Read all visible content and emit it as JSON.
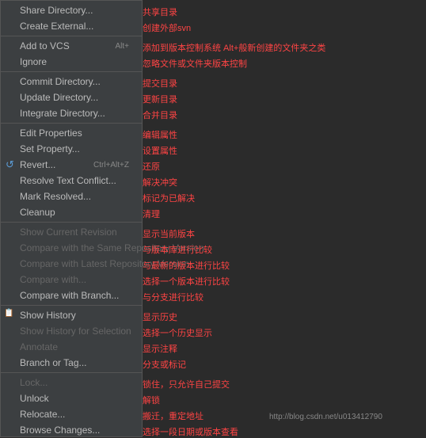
{
  "menu": {
    "items": [
      {
        "id": "share-directory",
        "label": "Share Directory...",
        "disabled": false,
        "shortcut": "",
        "annotation": "共享目录"
      },
      {
        "id": "create-external",
        "label": "Create External...",
        "disabled": false,
        "shortcut": "",
        "annotation": "创建外部svn"
      },
      {
        "id": "separator1",
        "type": "separator"
      },
      {
        "id": "add-to-vcs",
        "label": "Add to VCS",
        "disabled": false,
        "shortcut": "Alt+",
        "annotation": "添加到版本控制系统 Alt+般新创建的文件夹之类"
      },
      {
        "id": "ignore",
        "label": "Ignore",
        "disabled": false,
        "shortcut": "",
        "annotation": "忽略文件或文件夹版本控制"
      },
      {
        "id": "separator2",
        "type": "separator"
      },
      {
        "id": "commit-directory",
        "label": "Commit Directory...",
        "disabled": false,
        "shortcut": "",
        "annotation": "提交目录"
      },
      {
        "id": "update-directory",
        "label": "Update Directory...",
        "disabled": false,
        "shortcut": "",
        "annotation": "更新目录"
      },
      {
        "id": "integrate-directory",
        "label": "Integrate Directory...",
        "disabled": false,
        "shortcut": "",
        "annotation": "合并目录"
      },
      {
        "id": "separator3",
        "type": "separator"
      },
      {
        "id": "edit-properties",
        "label": "Edit Properties",
        "disabled": false,
        "shortcut": "",
        "annotation": "编辑属性"
      },
      {
        "id": "set-property",
        "label": "Set Property...",
        "disabled": false,
        "shortcut": "",
        "annotation": "设置属性"
      },
      {
        "id": "revert",
        "label": "Revert...",
        "disabled": false,
        "shortcut": "Ctrl+Alt+Z",
        "annotation": "还原",
        "icon": "revert"
      },
      {
        "id": "resolve-text-conflict",
        "label": "Resolve Text Conflict...",
        "disabled": false,
        "shortcut": "",
        "annotation": "解决冲突"
      },
      {
        "id": "mark-resolved",
        "label": "Mark Resolved...",
        "disabled": false,
        "shortcut": "",
        "annotation": "标记为已解决"
      },
      {
        "id": "cleanup",
        "label": "Cleanup",
        "disabled": false,
        "shortcut": "",
        "annotation": "清理"
      },
      {
        "id": "separator4",
        "type": "separator"
      },
      {
        "id": "show-current-revision",
        "label": "Show Current Revision",
        "disabled": true,
        "shortcut": "",
        "annotation": "显示当前版本"
      },
      {
        "id": "compare-same-repository",
        "label": "Compare with the Same Repository Version",
        "disabled": true,
        "shortcut": "",
        "annotation": "与版本库进行比较"
      },
      {
        "id": "compare-latest-repository",
        "label": "Compare with Latest Repository Version",
        "disabled": true,
        "shortcut": "",
        "annotation": "与最新的版本进行比较"
      },
      {
        "id": "compare-with",
        "label": "Compare with...",
        "disabled": true,
        "shortcut": "",
        "annotation": "选择一个版本进行比较"
      },
      {
        "id": "compare-branch",
        "label": "Compare with Branch...",
        "disabled": false,
        "shortcut": "",
        "annotation": "与分支进行比较"
      },
      {
        "id": "separator5",
        "type": "separator"
      },
      {
        "id": "show-history",
        "label": "Show History",
        "disabled": false,
        "shortcut": "",
        "annotation": "显示历史",
        "icon": "history"
      },
      {
        "id": "show-history-selection",
        "label": "Show History for Selection",
        "disabled": true,
        "shortcut": "",
        "annotation": "选择一个历史显示"
      },
      {
        "id": "annotate",
        "label": "Annotate",
        "disabled": true,
        "shortcut": "",
        "annotation": "显示注释"
      },
      {
        "id": "branch-or-tag",
        "label": "Branch or Tag...",
        "disabled": false,
        "shortcut": "",
        "annotation": "分支或标记"
      },
      {
        "id": "separator6",
        "type": "separator"
      },
      {
        "id": "lock",
        "label": "Lock...",
        "disabled": true,
        "shortcut": "",
        "annotation": "锁住，只允许自己提交"
      },
      {
        "id": "unlock",
        "label": "Unlock",
        "disabled": false,
        "shortcut": "",
        "annotation": "解锁"
      },
      {
        "id": "relocate",
        "label": "Relocate...",
        "disabled": false,
        "shortcut": "",
        "annotation": "搬迁，重定地址"
      },
      {
        "id": "browse-changes",
        "label": "Browse Changes...",
        "disabled": false,
        "shortcut": "",
        "annotation": "选择一段日期或版本查看"
      }
    ]
  },
  "watermark": "http://blog.csdn.net/u013412790"
}
